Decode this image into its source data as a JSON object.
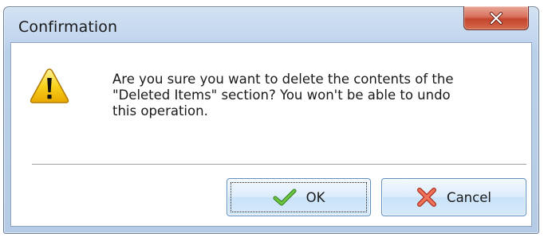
{
  "window": {
    "title": "Confirmation"
  },
  "message": {
    "lines": [
      "Are you sure you want to delete the contents of the",
      "\"Deleted Items\" section? You won't be able to undo",
      "this operation."
    ]
  },
  "buttons": {
    "ok_label": "OK",
    "cancel_label": "Cancel"
  },
  "icons": {
    "close": "close-icon",
    "warning": "warning-icon",
    "ok": "checkmark-icon",
    "cancel": "cross-icon"
  },
  "colors": {
    "title_bar": "#c2d6ee",
    "close_button": "#c4452d",
    "warning_fill": "#f5c400",
    "ok_check": "#4caf2a",
    "cancel_cross": "#e0503a"
  }
}
